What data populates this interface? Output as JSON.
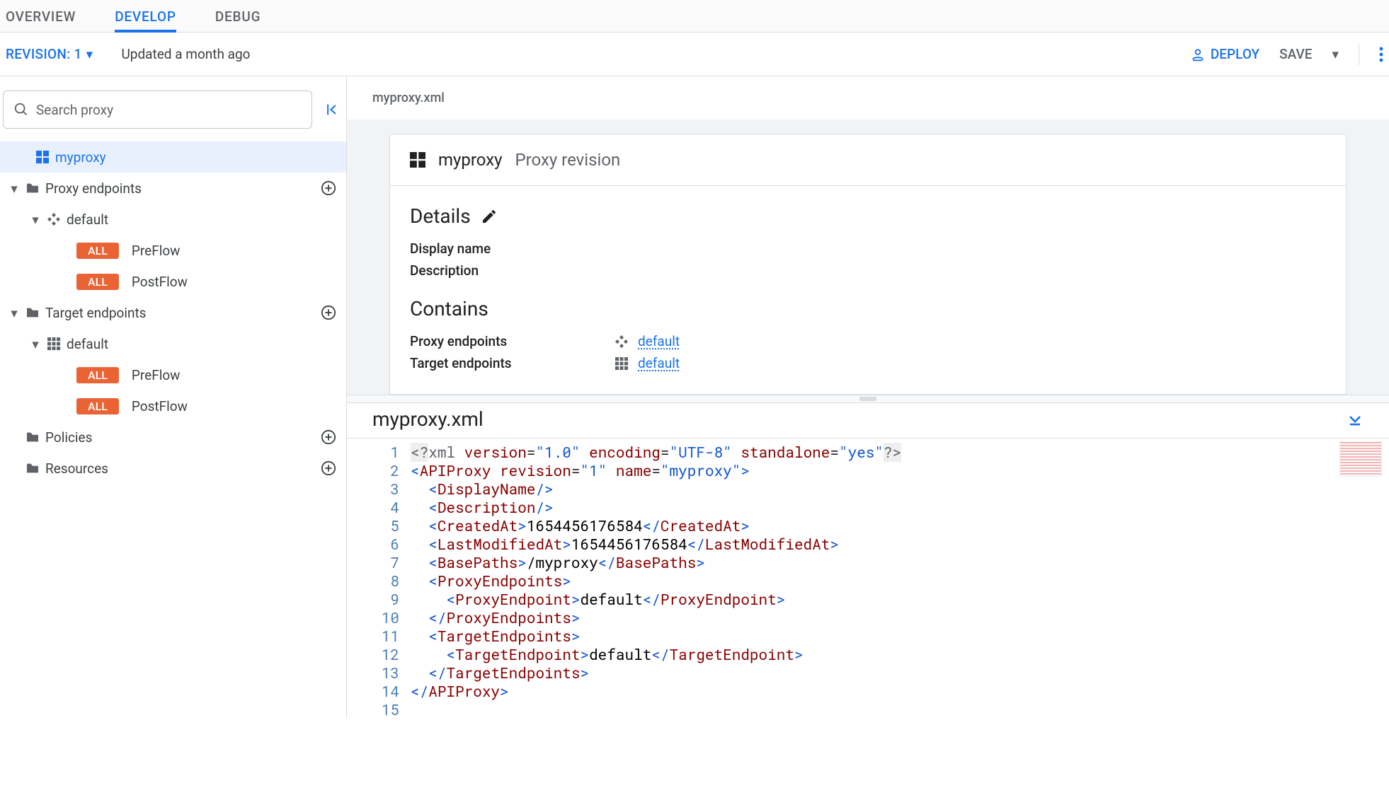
{
  "tabs": {
    "overview": "OVERVIEW",
    "develop": "DEVELOP",
    "debug": "DEBUG",
    "active": "develop"
  },
  "subbar": {
    "revision_label": "REVISION: 1",
    "updated": "Updated a month ago",
    "deploy": "DEPLOY",
    "save": "SAVE"
  },
  "sidebar": {
    "search_placeholder": "Search proxy",
    "root": "myproxy",
    "proxy_endpoints": "Proxy endpoints",
    "target_endpoints": "Target endpoints",
    "default": "default",
    "all": "ALL",
    "preflow": "PreFlow",
    "postflow": "PostFlow",
    "policies": "Policies",
    "resources": "Resources"
  },
  "content": {
    "crumb": "myproxy.xml",
    "card_name": "myproxy",
    "card_sub": "Proxy revision",
    "details": "Details",
    "display_name": "Display name",
    "description": "Description",
    "contains": "Contains",
    "proxy_endpoints": "Proxy endpoints",
    "target_endpoints": "Target endpoints",
    "default_link": "default",
    "editor_title": "myproxy.xml"
  },
  "xml": {
    "revision": "1",
    "name": "myproxy",
    "created_at": "1654456176584",
    "last_modified_at": "1654456176584",
    "base_path": "/myproxy",
    "proxy_endpoint": "default",
    "target_endpoint": "default"
  }
}
